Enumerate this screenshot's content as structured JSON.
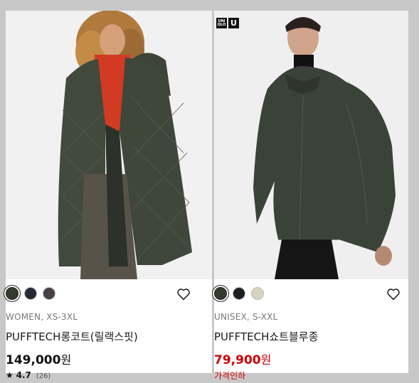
{
  "products": [
    {
      "category": "WOMEN, XS-3XL",
      "name": "PUFFTECH롱코트(릴랙스핏)",
      "price": "149,000",
      "currency": "원",
      "rating": "4.7",
      "rating_count": "(26)",
      "star": "★",
      "colors": [
        "#363b30",
        "#252a33",
        "#4a3f44"
      ]
    },
    {
      "category": "UNISEX, S-XXL",
      "name": "PUFFTECH쇼트블루종",
      "price": "79,900",
      "currency": "원",
      "sale_note": "가격인하",
      "colors": [
        "#363b30",
        "#1d1d22",
        "#d8d2bf"
      ],
      "logo_small": "UNI QLO",
      "logo_big": "U"
    }
  ]
}
